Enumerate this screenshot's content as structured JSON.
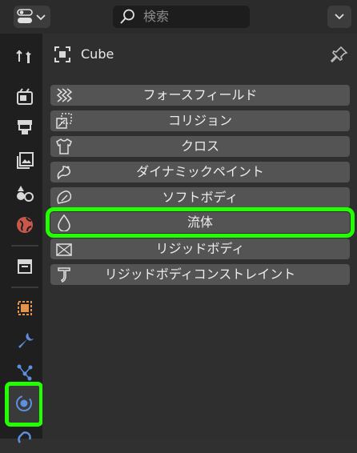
{
  "header": {
    "search": {
      "placeholder": "検索"
    }
  },
  "object": {
    "name": "Cube"
  },
  "physics_buttons": [
    {
      "label": "フォースフィールド",
      "icon": "force-field-icon"
    },
    {
      "label": "コリジョン",
      "icon": "collision-icon"
    },
    {
      "label": "クロス",
      "icon": "cloth-icon"
    },
    {
      "label": "ダイナミックペイント",
      "icon": "dynamic-paint-icon"
    },
    {
      "label": "ソフトボディ",
      "icon": "soft-body-icon"
    },
    {
      "label": "流体",
      "icon": "fluid-icon",
      "highlighted": true
    },
    {
      "label": "リジッドボディ",
      "icon": "rigid-body-icon"
    },
    {
      "label": "リジッドボディコンストレイント",
      "icon": "rigid-body-constraint-icon"
    }
  ],
  "tabs": [
    "tool-icon",
    "render-icon",
    "output-icon",
    "view-layer-icon",
    "scene-icon",
    "world-icon",
    "collection-icon",
    "object-icon",
    "modifier-icon",
    "particles-icon",
    "physics-icon",
    "constraints-icon"
  ],
  "colors": {
    "highlight": "#22ff00",
    "button_bg": "#545454",
    "panel_bg": "#2f2f2f"
  }
}
